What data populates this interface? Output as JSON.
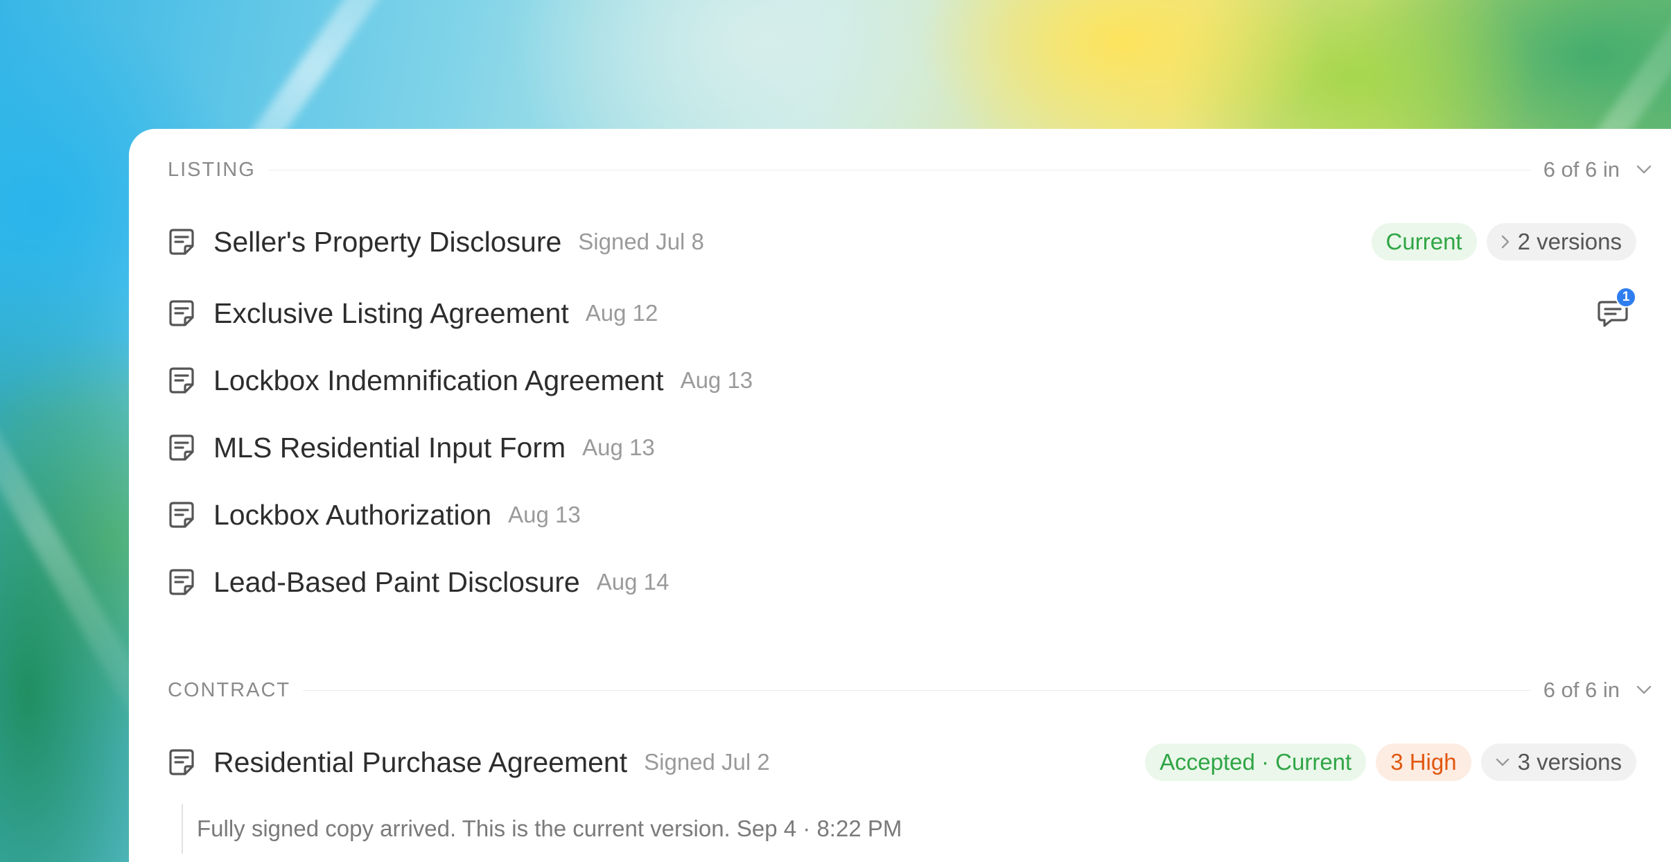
{
  "sections": [
    {
      "title": "LISTING",
      "count": "6 of 6 in",
      "items": [
        {
          "title": "Seller's Property Disclosure",
          "date": "Signed Jul 8",
          "status": "Current",
          "versions": "2 versions"
        },
        {
          "title": "Exclusive Listing Agreement",
          "date": "Aug 12",
          "comment_count": "1"
        },
        {
          "title": "Lockbox Indemnification Agreement",
          "date": "Aug 13"
        },
        {
          "title": "MLS Residential Input Form",
          "date": "Aug 13"
        },
        {
          "title": "Lockbox Authorization",
          "date": "Aug 13"
        },
        {
          "title": "Lead-Based Paint Disclosure",
          "date": "Aug 14"
        }
      ]
    },
    {
      "title": "CONTRACT",
      "count": "6 of 6 in",
      "items": [
        {
          "title": "Residential Purchase Agreement",
          "date": "Signed Jul 2",
          "status": "Accepted · Current",
          "priority": "3 High",
          "versions": "3 versions",
          "note": "Fully signed copy arrived. This is the current version. Sep 4 · 8:22 PM"
        }
      ]
    }
  ],
  "icons": {
    "document": "document-icon",
    "chevron_down": "chevron-down-icon",
    "chevron_right": "chevron-right-icon",
    "comment": "comment-icon"
  },
  "colors": {
    "status_green": "#2fa545",
    "priority_orange": "#e0570f",
    "badge_blue": "#2f7ef0"
  }
}
